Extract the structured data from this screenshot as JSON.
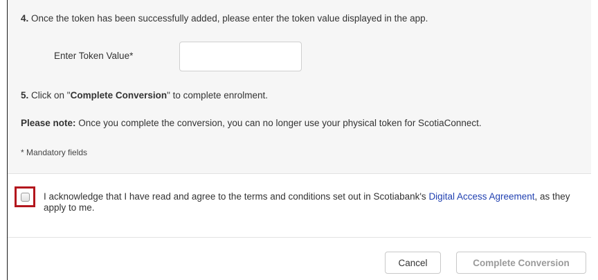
{
  "steps": {
    "step4": {
      "number": "4.",
      "text": "Once the token has been successfully added, please enter the token value displayed in the app."
    },
    "token": {
      "label": "Enter Token Value*",
      "value": "",
      "placeholder": ""
    },
    "step5": {
      "number": "5.",
      "prefix": "Click on \"",
      "action": "Complete Conversion",
      "suffix": "\" to complete enrolment."
    },
    "note": {
      "label": "Please note:",
      "text": " Once you complete the conversion, you can no longer use your physical token for ScotiaConnect."
    },
    "mandatory": "* Mandatory fields"
  },
  "acknowledgement": {
    "checked": false,
    "text_before": "I acknowledge that I have read and agree to the terms and conditions set out in Scotiabank's ",
    "link_text": "Digital Access Agreement",
    "text_after": ", as they apply to me."
  },
  "buttons": {
    "cancel": "Cancel",
    "complete": "Complete Conversion"
  },
  "colors": {
    "highlight_border": "#b3161d",
    "link": "#1f3fb0",
    "disabled_text": "#9a9a9a"
  }
}
